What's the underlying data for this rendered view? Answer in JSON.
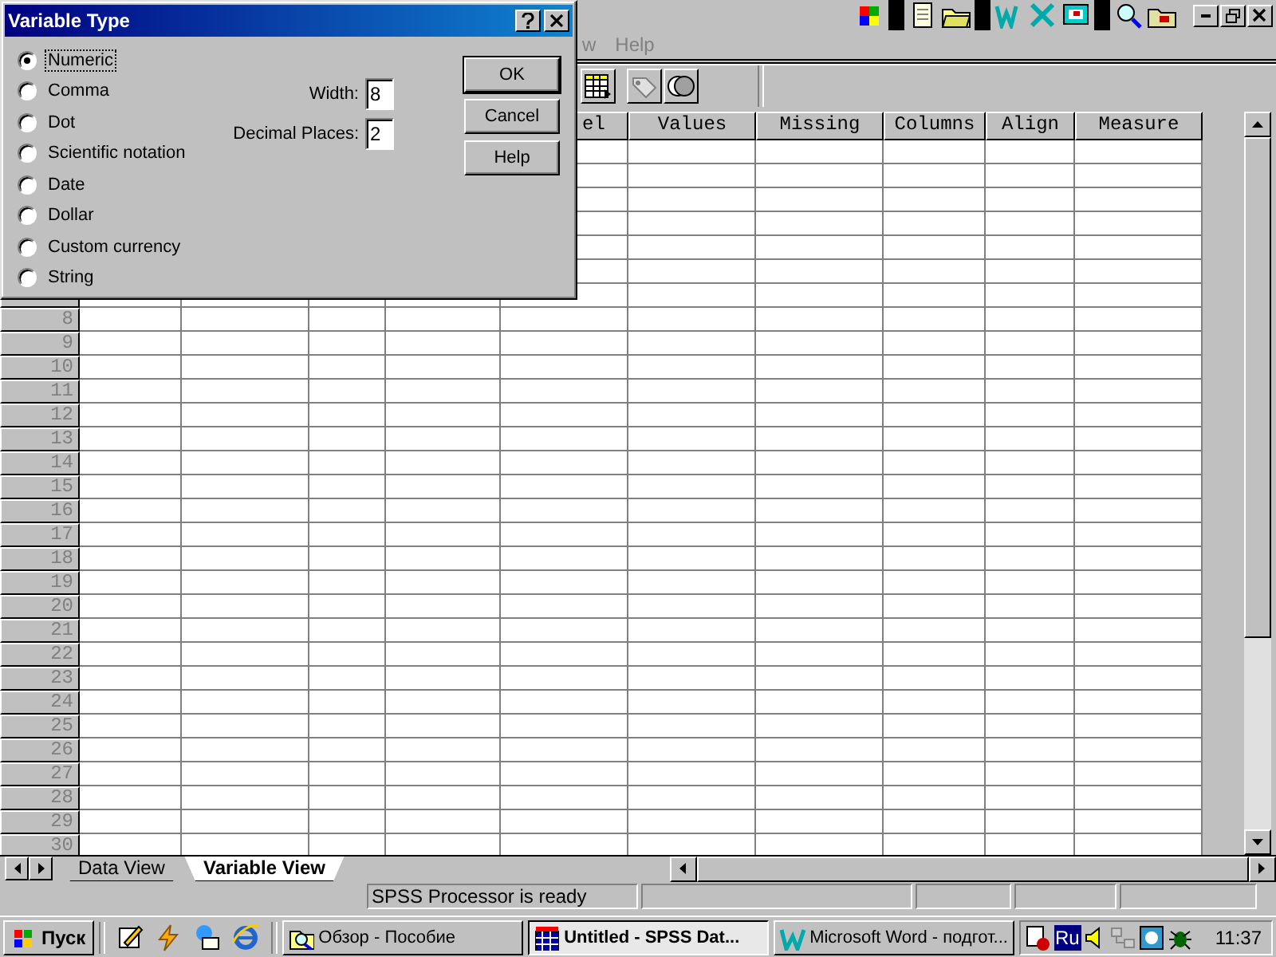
{
  "dialog": {
    "title": "Variable Type",
    "types": [
      {
        "label": "Numeric",
        "selected": true
      },
      {
        "label": "Comma",
        "selected": false
      },
      {
        "label": "Dot",
        "selected": false
      },
      {
        "label": "Scientific notation",
        "selected": false
      },
      {
        "label": "Date",
        "selected": false
      },
      {
        "label": "Dollar",
        "selected": false
      },
      {
        "label": "Custom currency",
        "selected": false
      },
      {
        "label": "String",
        "selected": false
      }
    ],
    "fields": [
      {
        "label": "Width:",
        "value": "8"
      },
      {
        "label": "Decimal Places:",
        "value": "2"
      }
    ],
    "buttons": [
      "OK",
      "Cancel",
      "Help"
    ]
  },
  "menu": [
    "w",
    "Help"
  ],
  "grid": {
    "columns": [
      "el",
      "Values",
      "Missing",
      "Columns",
      "Align",
      "Measure"
    ],
    "row_numbers": [
      "8",
      "9",
      "10",
      "11",
      "12",
      "13",
      "14",
      "15",
      "16",
      "17",
      "18",
      "19",
      "20",
      "21",
      "22",
      "23",
      "24",
      "25",
      "26",
      "27",
      "28",
      "29",
      "30"
    ]
  },
  "sheet_tabs": [
    {
      "label": "Data View",
      "selected": false
    },
    {
      "label": "Variable View",
      "selected": true
    }
  ],
  "status_bar": [
    "SPSS Processor  is ready"
  ],
  "taskbar": {
    "start": "Пуск",
    "tasks": [
      {
        "label": "Обзор - Пособие",
        "selected": false,
        "kind": "browser"
      },
      {
        "label": "Untitled - SPSS Dat...",
        "selected": true,
        "kind": "spss"
      },
      {
        "label": "Microsoft Word - подгот...",
        "selected": false,
        "kind": "word"
      }
    ],
    "language": "Ru",
    "clock": "11:37"
  }
}
